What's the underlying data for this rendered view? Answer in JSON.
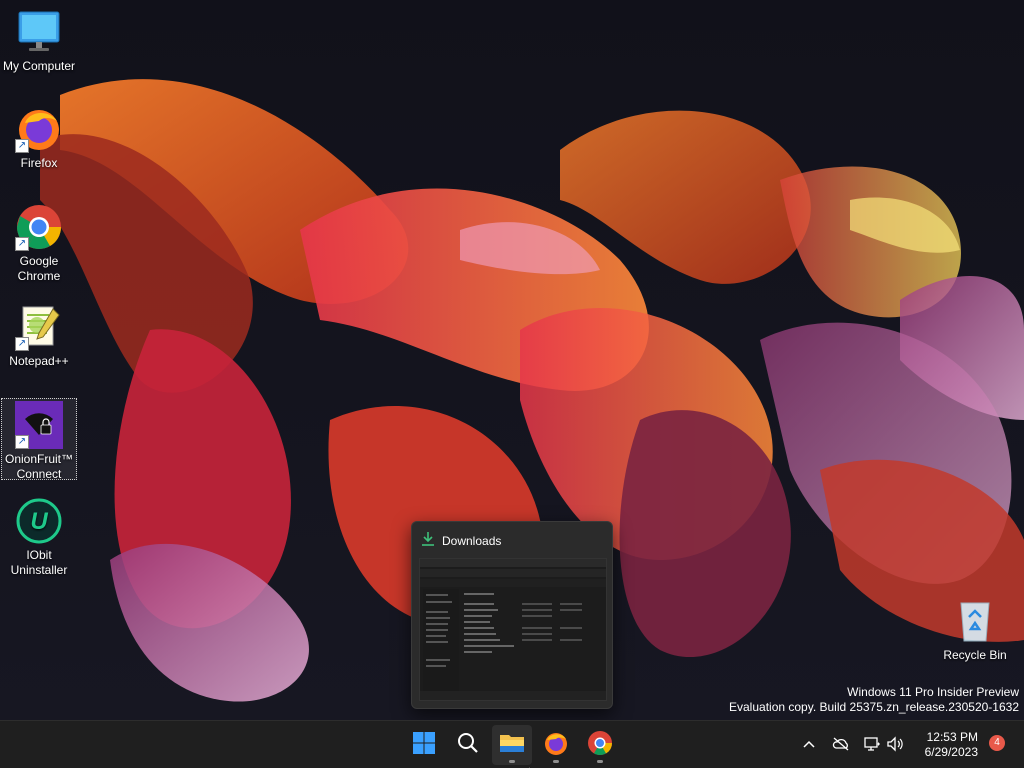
{
  "desktop": {
    "icons": [
      {
        "label": "My Computer",
        "icon": "monitor-icon"
      },
      {
        "label": "Firefox",
        "icon": "firefox-icon"
      },
      {
        "label": "Google Chrome",
        "icon": "chrome-icon"
      },
      {
        "label": "Notepad++",
        "icon": "notepad-plus-plus-icon"
      },
      {
        "label": "OnionFruit™ Connect",
        "icon": "onionfruit-icon"
      },
      {
        "label": "IObit Uninstaller",
        "icon": "iobit-uninstaller-icon"
      },
      {
        "label": "Recycle Bin",
        "icon": "recycle-bin-icon"
      }
    ],
    "watermark": {
      "line1": "Windows 11 Pro Insider Preview",
      "line2": "Evaluation copy. Build 25375.zn_release.230520-1632"
    }
  },
  "preview": {
    "title": "Downloads",
    "icon": "download-icon"
  },
  "taskbar": {
    "buttons": [
      {
        "name": "start-button",
        "icon": "windows-logo-icon"
      },
      {
        "name": "search-button",
        "icon": "search-icon"
      },
      {
        "name": "file-explorer-button",
        "icon": "folder-icon",
        "active": true
      },
      {
        "name": "firefox-taskbar-button",
        "icon": "firefox-icon"
      },
      {
        "name": "chrome-taskbar-button",
        "icon": "chrome-icon"
      }
    ],
    "tray": {
      "icons": [
        "chevron-up-icon",
        "cloud-off-icon",
        "network-icon",
        "volume-icon"
      ],
      "time": "12:53 PM",
      "date": "6/29/2023",
      "notification_count": "4"
    }
  },
  "colors": {
    "taskbar_bg": "#1f1f1f",
    "accent_blue": "#0a84ff",
    "badge_red": "#e8594a"
  }
}
